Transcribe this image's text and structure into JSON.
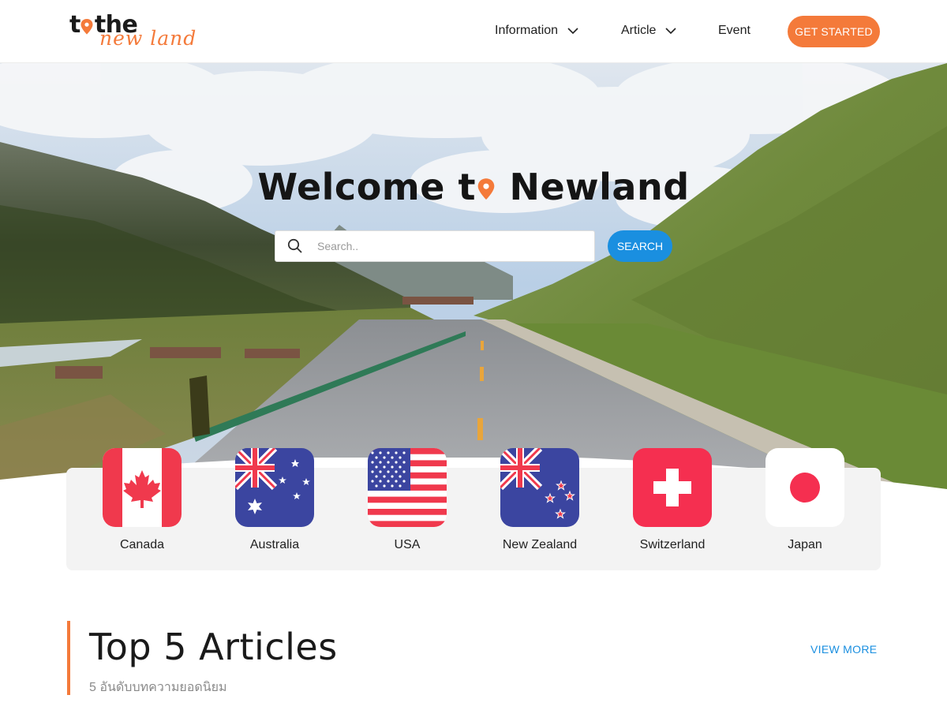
{
  "brand": {
    "logo_main": "the",
    "logo_prefix": "t",
    "logo_script": "new land",
    "accent_color": "#f47a3a",
    "primary_blue": "#1a8fe0"
  },
  "nav": {
    "items": [
      {
        "label": "Information",
        "has_dropdown": true
      },
      {
        "label": "Article",
        "has_dropdown": true
      },
      {
        "label": "Event",
        "has_dropdown": false
      }
    ],
    "cta_label": "GET STARTED"
  },
  "hero": {
    "title_before": "Welcome t",
    "title_after": " Newland",
    "search_placeholder": "Search..",
    "search_button": "SEARCH",
    "icon": "search-icon"
  },
  "countries": [
    {
      "name": "Canada",
      "icon": "canada-flag-icon"
    },
    {
      "name": "Australia",
      "icon": "australia-flag-icon"
    },
    {
      "name": "USA",
      "icon": "usa-flag-icon"
    },
    {
      "name": "New Zealand",
      "icon": "new-zealand-flag-icon"
    },
    {
      "name": "Switzerland",
      "icon": "switzerland-flag-icon"
    },
    {
      "name": "Japan",
      "icon": "japan-flag-icon"
    }
  ],
  "articles": {
    "title": "Top 5 Articles",
    "subtitle": "5 อันดับบทความยอดนิยม",
    "view_more": "VIEW MORE"
  }
}
